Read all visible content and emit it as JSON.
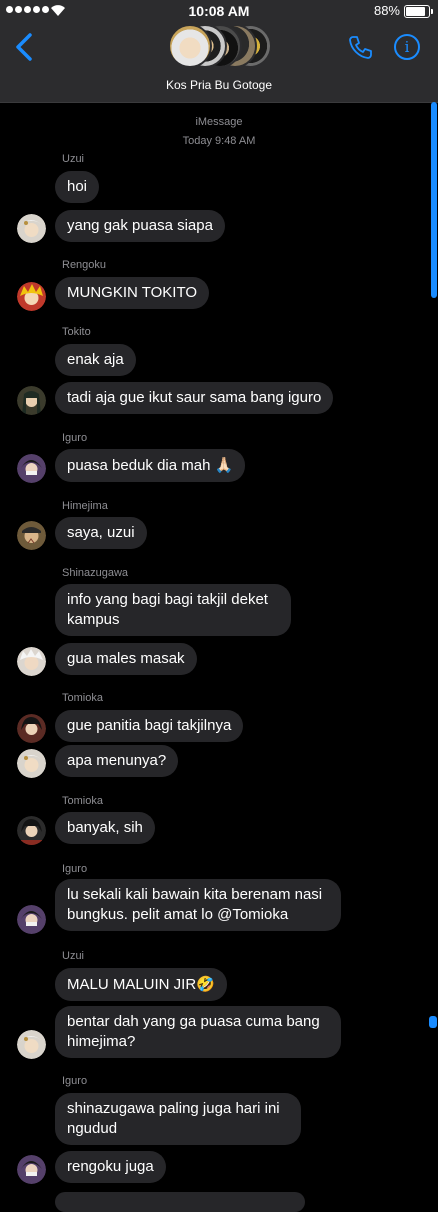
{
  "status_bar": {
    "time": "10:08 AM",
    "battery": "88%"
  },
  "header": {
    "title": "Kos Pria Bu Gotoge"
  },
  "thread": {
    "service": "iMessage",
    "timestamp": "Today 9:48 AM"
  },
  "messages": [
    {
      "sender": "Uzui",
      "text": "hoi"
    },
    {
      "text": "yang gak puasa siapa"
    },
    {
      "sender": "Rengoku",
      "text": "MUNGKIN TOKITO"
    },
    {
      "sender": "Tokito",
      "text": "enak aja"
    },
    {
      "text": "tadi aja gue ikut saur sama bang iguro"
    },
    {
      "sender": "Iguro",
      "text": "puasa beduk dia mah",
      "emoji": "🙏🏻"
    },
    {
      "sender": "Himejima",
      "text": "saya, uzui"
    },
    {
      "sender": "Shinazugawa",
      "text": "info yang bagi bagi takjil deket kampus"
    },
    {
      "text": "gua males masak"
    },
    {
      "sender": "Tomioka",
      "text": "gue panitia bagi takjilnya"
    },
    {
      "text": "apa menunya?"
    },
    {
      "sender": "Tomioka",
      "text": "banyak, sih"
    },
    {
      "sender": "Iguro",
      "text": "lu sekali kali bawain kita berenam nasi bungkus. pelit amat lo @Tomioka"
    },
    {
      "sender": "Uzui",
      "text": "MALU MALUIN JIR",
      "emoji": "🤣"
    },
    {
      "text": "bentar dah yang ga puasa cuma bang himejima?"
    },
    {
      "sender": "Iguro",
      "text": "shinazugawa paling juga hari ini ngudud"
    },
    {
      "text": "rengoku juga"
    }
  ],
  "colors": {
    "background": "#000000",
    "header": "#2c2c2e",
    "bubble": "#262629",
    "accent": "#1a8cff",
    "meta_text": "#8e8e93"
  },
  "icons": [
    "chevron-left-icon",
    "phone-icon",
    "info-icon",
    "wifi-icon",
    "battery-icon"
  ]
}
